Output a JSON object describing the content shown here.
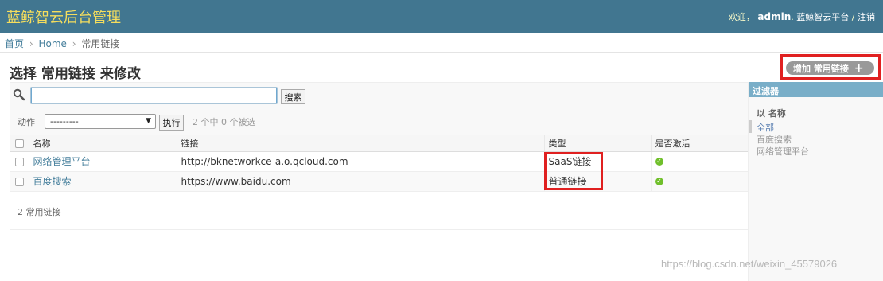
{
  "header": {
    "brand": "蓝鲸智云后台管理",
    "welcome": "欢迎，",
    "username": "admin",
    "site_link": "蓝鲸智云平台",
    "separator": "/",
    "logout": "注销"
  },
  "breadcrumbs": {
    "items": [
      "首页",
      "Home",
      "常用链接"
    ],
    "separator": "›"
  },
  "page_title": "选择 常用链接 来修改",
  "add_button": {
    "label": "增加 常用链接",
    "icon": "plus-icon"
  },
  "search": {
    "value": "",
    "placeholder": "",
    "button_label": "搜索",
    "icon": "search-icon"
  },
  "actions": {
    "label": "动作",
    "select_value": "---------",
    "go_label": "执行",
    "selection_count": "2 个中 0 个被选"
  },
  "table": {
    "columns": [
      "名称",
      "链接",
      "类型",
      "是否激活"
    ],
    "rows": [
      {
        "name": "网络管理平台",
        "link": "http://bknetworkce-a.o.qcloud.com",
        "type": "SaaS链接",
        "active_icon": "check-circle-icon"
      },
      {
        "name": "百度搜索",
        "link": "https://www.baidu.com",
        "type": "普通链接",
        "active_icon": "check-circle-icon"
      }
    ]
  },
  "paginator": "2 常用链接",
  "filter": {
    "title": "过滤器",
    "group_title": "以 名称",
    "options": [
      "全部",
      "百度搜索",
      "网络管理平台"
    ],
    "selected": "全部"
  },
  "watermark": "https://blog.csdn.net/weixin_45579026",
  "colors": {
    "header_bg": "#417690",
    "brand": "#f5dd5d",
    "link": "#447e9b",
    "filter_header": "#79aec8",
    "highlight_border": "#e02020",
    "active_ok": "#70bf2b"
  }
}
